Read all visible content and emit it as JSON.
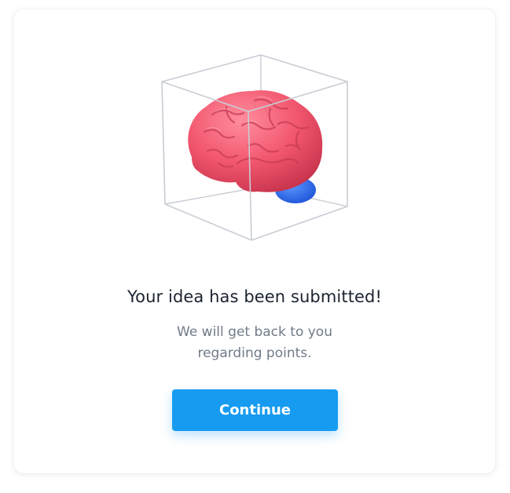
{
  "dialog": {
    "title": "Your idea has been submitted!",
    "message_line1": "We will get back to you",
    "message_line2": "regarding points.",
    "continue_label": "Continue"
  },
  "illustration": {
    "icon": "brain-in-cube-icon",
    "colors": {
      "brain": "#f2576f",
      "cerebellum": "#2f6ff0",
      "cube_lines": "#c8cdd4"
    }
  },
  "colors": {
    "accent": "#169bf1",
    "title_text": "#1b2330",
    "body_text": "#707a88"
  }
}
